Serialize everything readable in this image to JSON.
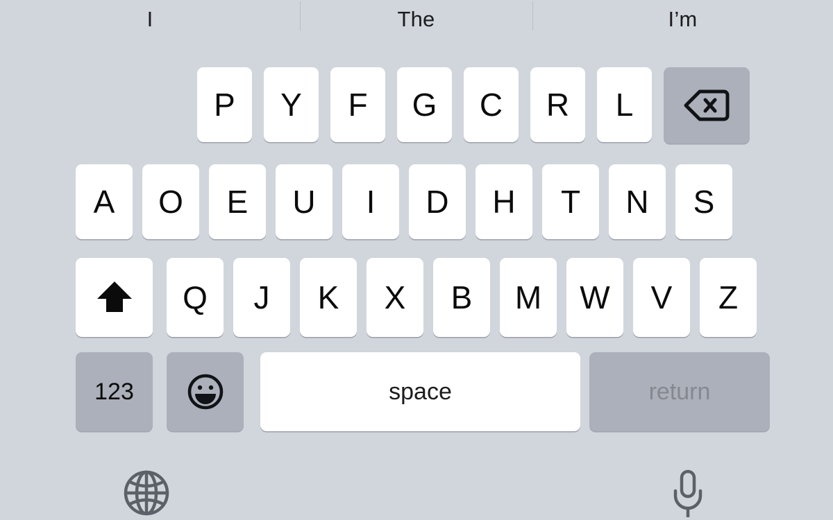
{
  "suggestion_bar": {
    "name": "predictive-text-bar",
    "suggestions": [
      {
        "label": "I"
      },
      {
        "label": "The"
      },
      {
        "label": "I’m"
      }
    ]
  },
  "keyboard": {
    "layout_name": "Dvorak",
    "colors": {
      "background": "#d1d5dc",
      "key_light": "#ffffff",
      "key_dark": "#acb0ba",
      "key_text": "#0b0b0c",
      "return_text": "#85898f",
      "divider": "#b9bec6",
      "icon_stroke": "#5c6068"
    },
    "rows": [
      {
        "name": "row-1",
        "keys": [
          {
            "label": "P",
            "type": "letter"
          },
          {
            "label": "Y",
            "type": "letter"
          },
          {
            "label": "F",
            "type": "letter"
          },
          {
            "label": "G",
            "type": "letter"
          },
          {
            "label": "C",
            "type": "letter"
          },
          {
            "label": "R",
            "type": "letter"
          },
          {
            "label": "L",
            "type": "letter"
          },
          {
            "label": "",
            "type": "backspace",
            "icon": "backspace-icon"
          }
        ]
      },
      {
        "name": "row-2",
        "keys": [
          {
            "label": "A",
            "type": "letter"
          },
          {
            "label": "O",
            "type": "letter"
          },
          {
            "label": "E",
            "type": "letter"
          },
          {
            "label": "U",
            "type": "letter"
          },
          {
            "label": "I",
            "type": "letter"
          },
          {
            "label": "D",
            "type": "letter"
          },
          {
            "label": "H",
            "type": "letter"
          },
          {
            "label": "T",
            "type": "letter"
          },
          {
            "label": "N",
            "type": "letter"
          },
          {
            "label": "S",
            "type": "letter"
          }
        ]
      },
      {
        "name": "row-3",
        "keys": [
          {
            "label": "",
            "type": "shift",
            "icon": "shift-icon",
            "state": "active"
          },
          {
            "label": "Q",
            "type": "letter"
          },
          {
            "label": "J",
            "type": "letter"
          },
          {
            "label": "K",
            "type": "letter"
          },
          {
            "label": "X",
            "type": "letter"
          },
          {
            "label": "B",
            "type": "letter"
          },
          {
            "label": "M",
            "type": "letter"
          },
          {
            "label": "W",
            "type": "letter"
          },
          {
            "label": "V",
            "type": "letter"
          },
          {
            "label": "Z",
            "type": "letter"
          }
        ]
      },
      {
        "name": "row-4",
        "keys": [
          {
            "label": "123",
            "type": "numeric"
          },
          {
            "label": "",
            "type": "emoji",
            "icon": "smiley-face-icon"
          },
          {
            "label": "space",
            "type": "space"
          },
          {
            "label": "return",
            "type": "return"
          }
        ]
      }
    ]
  },
  "utility_row": {
    "globe": {
      "name": "globe-icon",
      "label": "globe"
    },
    "microphone": {
      "name": "microphone-icon",
      "label": "microphone"
    }
  }
}
